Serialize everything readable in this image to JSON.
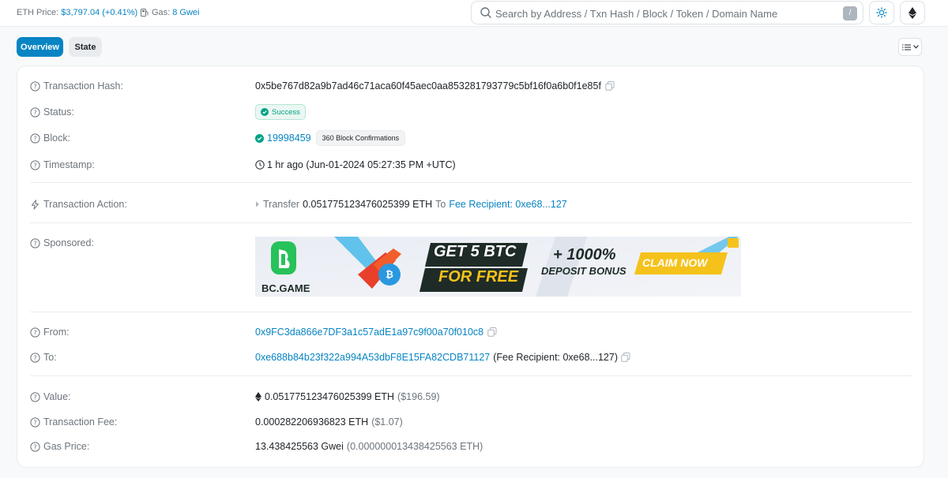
{
  "header": {
    "eth_price_label": "ETH Price:",
    "eth_price_value": "$3,797.04 (+0.41%)",
    "gas_label": "Gas:",
    "gas_value": "8 Gwei",
    "search_placeholder": "Search by Address / Txn Hash / Block / Token / Domain Name",
    "search_shortcut": "/",
    "theme_icon": "sun-icon",
    "network_icon": "ethereum-icon"
  },
  "tabs": [
    {
      "label": "Overview",
      "active": true
    },
    {
      "label": "State",
      "active": false
    }
  ],
  "fields": {
    "tx_hash_label": "Transaction Hash:",
    "tx_hash_value": "0x5be767d82a9b7ad46c71aca60f45aec0aa853281793779c5bf16f0a6b0f1e85f",
    "status_label": "Status:",
    "status_value": "Success",
    "block_label": "Block:",
    "block_value": "19998459",
    "block_confirmations": "360 Block Confirmations",
    "timestamp_label": "Timestamp:",
    "timestamp_value": "1 hr ago (Jun-01-2024 05:27:35 PM +UTC)",
    "action_label": "Transaction Action:",
    "action_prefix": "Transfer",
    "action_amount": "0.051775123476025399 ETH",
    "action_to": "To",
    "action_recipient": "Fee Recipient: 0xe68...127",
    "sponsored_label": "Sponsored:",
    "from_label": "From:",
    "from_value": "0x9FC3da866e7DF3a1c57adE1a97c9f00a70f010c8",
    "to_label": "To:",
    "to_value": "0xe688b84b23f322a994A53dbF8E15FA82CDB71127",
    "to_note": "(Fee Recipient: 0xe68...127)",
    "value_label": "Value:",
    "value_eth": "0.051775123476025399 ETH",
    "value_usd": "($196.59)",
    "fee_label": "Transaction Fee:",
    "fee_eth": "0.000282206936823 ETH",
    "fee_usd": "($1.07)",
    "gas_price_label": "Gas Price:",
    "gas_price_gwei": "13.438425563 Gwei",
    "gas_price_eth": "(0.000000013438425563 ETH)"
  },
  "ad": {
    "brand": "BC.GAME",
    "headline_1": "GET 5 BTC",
    "headline_2": "FOR FREE",
    "bonus_1": "+ 1000%",
    "bonus_2": "DEPOSIT BONUS",
    "cta": "CLAIM NOW",
    "colors": {
      "brand_green": "#27c25a",
      "gold": "#f5c21b",
      "dark": "#1e2b27",
      "orange": "#f25d2c"
    }
  },
  "colors": {
    "link": "#0784c3",
    "success": "#00a186",
    "muted": "#6c757d"
  }
}
